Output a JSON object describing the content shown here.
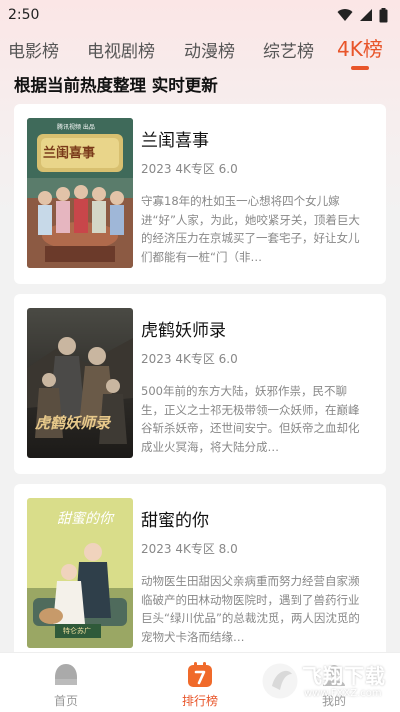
{
  "status_bar": {
    "time": "2:50"
  },
  "tabs": [
    {
      "label": "电影榜",
      "active": false
    },
    {
      "label": "电视剧榜",
      "active": false
    },
    {
      "label": "动漫榜",
      "active": false
    },
    {
      "label": "综艺榜",
      "active": false
    },
    {
      "label": "4K榜",
      "active": true
    }
  ],
  "subtitle": "根据当前热度整理 实时更新",
  "items": [
    {
      "title": "兰闺喜事",
      "meta": "2023 4K专区 6.0",
      "desc": "守寡18年的杜如玉一心想将四个女儿嫁进“好”人家，为此，她咬紧牙关，顶着巨大的经济压力在京城买了一套宅子，好让女儿们都能有一桩“门（非…",
      "poster_text": "兰闺喜事",
      "poster_badge": "腾讯视频 出品"
    },
    {
      "title": "虎鹤妖师录",
      "meta": "2023 4K专区 6.0",
      "desc": "500年前的东方大陆，妖邪作祟，民不聊生，正义之士祁无极带领一众妖师，在巅峰谷斩杀妖帝，还世间安宁。但妖帝之血却化成业火冥海，将大陆分成…",
      "poster_text": "虎鹤妖师录"
    },
    {
      "title": "甜蜜的你",
      "meta": "2023 4K专区 8.0",
      "desc": "动物医生田甜因父亲病重而努力经营自家濒临破产的田林动物医院时，遇到了兽药行业巨头“绿川优品”的总裁沈觅，两人因沈觅的宠物犬卡洛而结缘…",
      "poster_text": "甜蜜的你",
      "poster_badge": "特仑苏广"
    }
  ],
  "bottom_nav": [
    {
      "label": "首页",
      "active": false
    },
    {
      "label": "排行榜",
      "active": true
    },
    {
      "label": "我的",
      "active": false
    }
  ],
  "watermark": {
    "brand": "飞翔下载",
    "url": "www.FXXZ.com"
  },
  "colors": {
    "accent": "#e8552a",
    "muted": "#888888"
  }
}
